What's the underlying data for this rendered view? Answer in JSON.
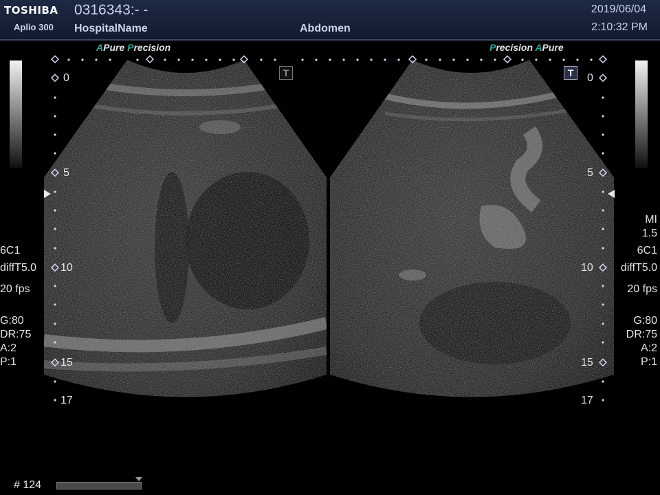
{
  "header": {
    "brand": "TOSHIBA",
    "model": "Aplio 300",
    "patient_id": "0316343:- -",
    "hospital": "HospitalName",
    "exam": "Abdomen",
    "date": "2019/06/04",
    "time": "2:10:32 PM"
  },
  "left_tag": {
    "a": "A",
    "pure": "Pure",
    "p": "P",
    "precision": "recision"
  },
  "right_tag": {
    "p": "P",
    "precision": "recision",
    "a": "A",
    "pure": "Pure"
  },
  "left_params": {
    "probe": "6C1",
    "mode": "diffT5.0",
    "fps": "20 fps",
    "gain": "G:80",
    "dr": "DR:75",
    "a": "A:2",
    "p": "P:1"
  },
  "right_params": {
    "mi_label": "MI",
    "mi_value": "1.5",
    "probe": "6C1",
    "mode": "diffT5.0",
    "fps": "20 fps",
    "gain": "G:80",
    "dr": "DR:75",
    "a": "A:2",
    "p": "P:1"
  },
  "depth_labels": [
    "0",
    "5",
    "10",
    "15",
    "17"
  ],
  "footer": {
    "frame": "# 124"
  },
  "toggle_left": "T",
  "toggle_right": "T",
  "colors": {
    "header_bg": "#1d2a44",
    "accent": "#2aa89a",
    "text": "#c9d4e8"
  }
}
